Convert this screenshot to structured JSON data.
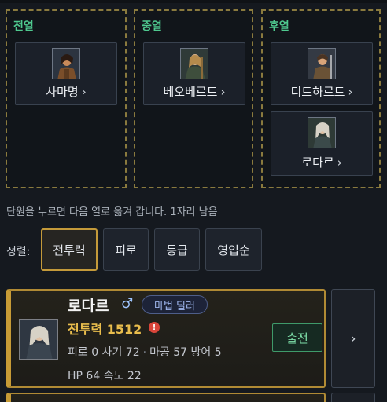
{
  "formation": {
    "front": {
      "title": "전열",
      "units": [
        {
          "name": "사마명"
        }
      ]
    },
    "middle": {
      "title": "중열",
      "units": [
        {
          "name": "베오베르트"
        }
      ]
    },
    "back": {
      "title": "후열",
      "units": [
        {
          "name": "디트하르트"
        },
        {
          "name": "로다르"
        }
      ]
    }
  },
  "chevron": "›",
  "hint": "단원을 누르면 다음 열로 옮겨 갑니다. 1자리 남음",
  "sort": {
    "label": "정렬:",
    "options": [
      "전투력",
      "피로",
      "등급",
      "영입순"
    ],
    "selected": "전투력"
  },
  "units": [
    {
      "name": "로다르",
      "gender": "♂",
      "class": "마법 딜러",
      "power_label": "전투력",
      "power": "1512",
      "warn": "!",
      "stats_line1": [
        "피로 0",
        "사기 72",
        "마공 57",
        "방어 5"
      ],
      "stats_line2": [
        "HP 64",
        "속도 22"
      ],
      "deploy_label": "출전"
    }
  ],
  "colors": {
    "accent_gold": "#c79b36",
    "zone_title": "#4fc98f",
    "power": "#e9bd4d",
    "deploy": "#7fe0aa"
  }
}
